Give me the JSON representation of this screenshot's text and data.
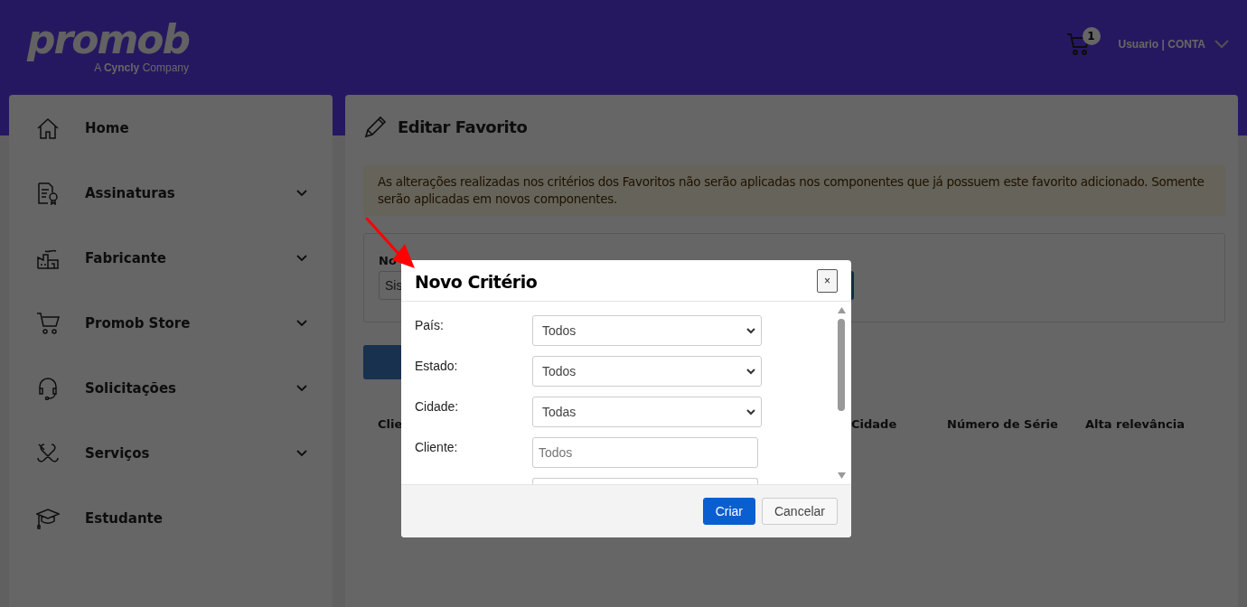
{
  "header": {
    "logo": "promob",
    "tagline": "A **Cyncly** Company",
    "cart_badge": "1",
    "user": "Usuario | CONTA"
  },
  "sidebar": {
    "items": [
      {
        "label": "Home",
        "expandable": false
      },
      {
        "label": "Assinaturas",
        "expandable": true
      },
      {
        "label": "Fabricante",
        "expandable": true
      },
      {
        "label": "Promob Store",
        "expandable": true
      },
      {
        "label": "Solicitações",
        "expandable": true
      },
      {
        "label": "Serviços",
        "expandable": true
      },
      {
        "label": "Estudante",
        "expandable": false
      }
    ]
  },
  "page": {
    "title": "Editar Favorito",
    "notice": "As alterações realizadas nos critérios dos Favoritos não serão aplicadas nos componentes que já possuem este favorito adicionado. Somente serão aplicadas em novos componentes.",
    "form": {
      "label": "No",
      "placeholder": "Sis"
    },
    "table": {
      "columns": [
        "Clie",
        "Cidade",
        "Número de Série",
        "Alta relevância"
      ]
    }
  },
  "modal": {
    "title": "Novo Critério",
    "close": "×",
    "fields": [
      {
        "label": "País:",
        "kind": "select",
        "value": "Todos"
      },
      {
        "label": "Estado:",
        "kind": "select",
        "value": "Todos"
      },
      {
        "label": "Cidade:",
        "kind": "select",
        "value": "Todas"
      },
      {
        "label": "Cliente:",
        "kind": "text",
        "placeholder": "Todos"
      }
    ],
    "buttons": [
      {
        "label": "Criar",
        "primary": true
      },
      {
        "label": "Cancelar",
        "primary": false
      }
    ]
  }
}
